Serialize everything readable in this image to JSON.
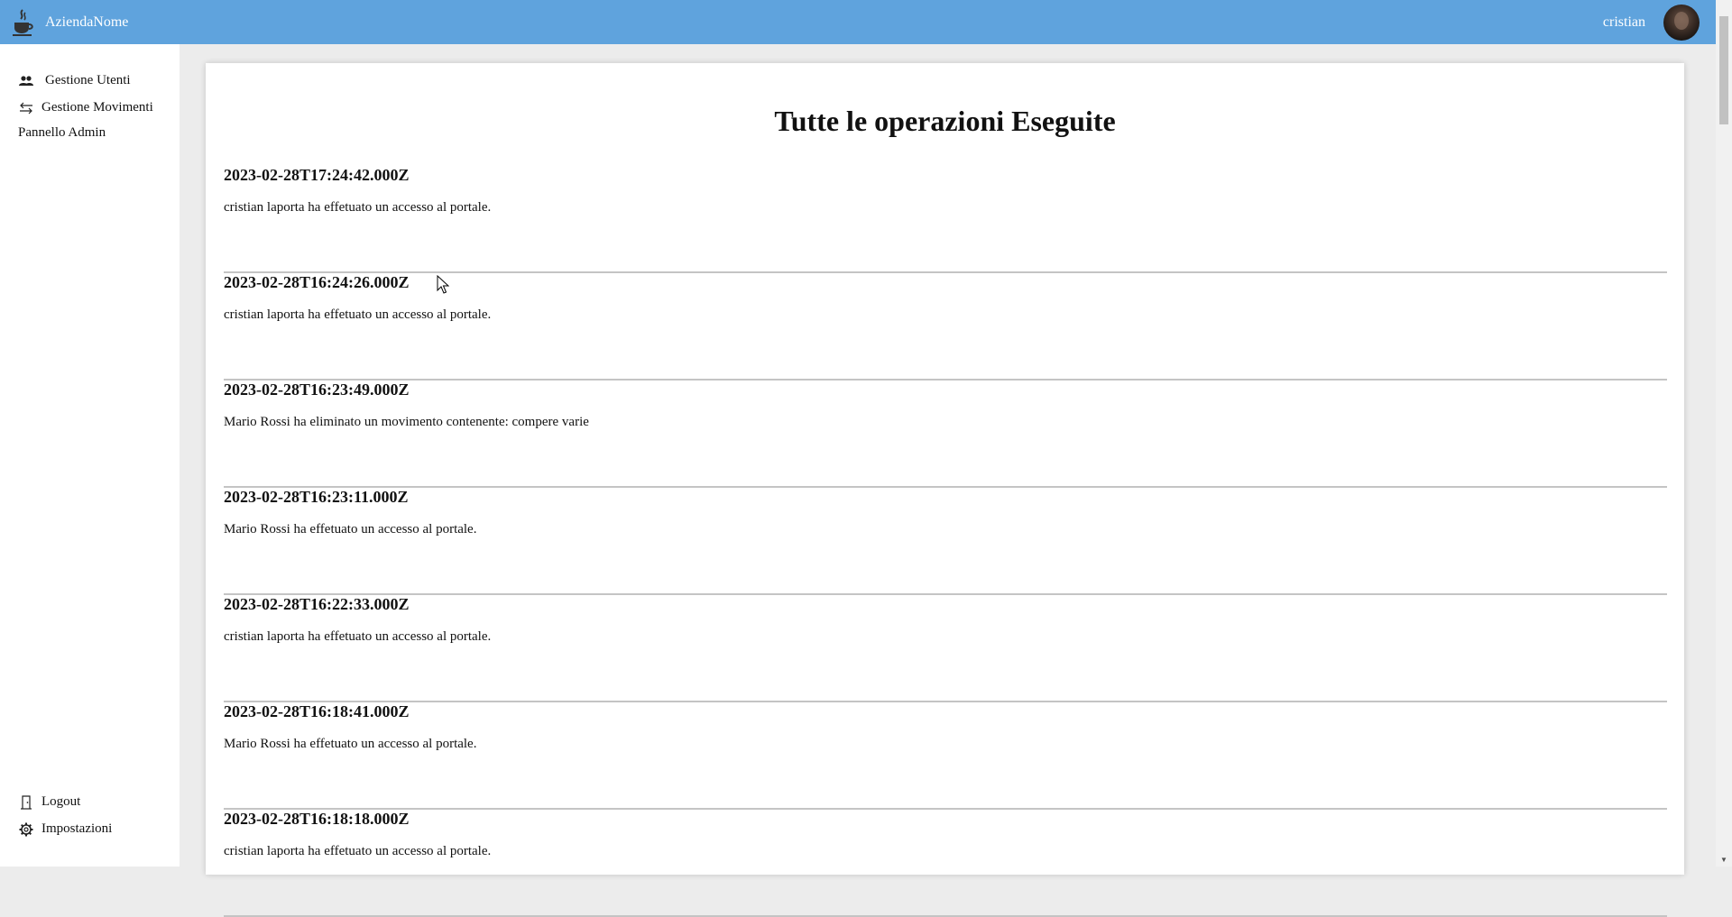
{
  "header": {
    "brand": "AziendaNome",
    "brand_icon": "java-cup-icon",
    "username": "cristian",
    "bar_color": "#5fa3dd"
  },
  "sidebar": {
    "items": [
      {
        "label": "Gestione Utenti",
        "icon": "users-icon"
      },
      {
        "label": "Gestione Movimenti",
        "icon": "arrows-exchange-icon"
      },
      {
        "label": "Pannello Admin",
        "icon": ""
      }
    ],
    "bottom_items": [
      {
        "label": "Logout",
        "icon": "door-icon"
      },
      {
        "label": "Impostazioni",
        "icon": "gear-icon"
      }
    ]
  },
  "main": {
    "title": "Tutte le operazioni Eseguite",
    "operations": [
      {
        "date": "2023-02-28T17:24:42.000Z",
        "text": "cristian laporta ha effetuato un accesso al portale."
      },
      {
        "date": "2023-02-28T16:24:26.000Z",
        "text": "cristian laporta ha effetuato un accesso al portale."
      },
      {
        "date": "2023-02-28T16:23:49.000Z",
        "text": "Mario Rossi ha eliminato un movimento contenente: compere varie"
      },
      {
        "date": "2023-02-28T16:23:11.000Z",
        "text": "Mario Rossi ha effetuato un accesso al portale."
      },
      {
        "date": "2023-02-28T16:22:33.000Z",
        "text": "cristian laporta ha effetuato un accesso al portale."
      },
      {
        "date": "2023-02-28T16:18:41.000Z",
        "text": "Mario Rossi ha effetuato un accesso al portale."
      },
      {
        "date": "2023-02-28T16:18:18.000Z",
        "text": "cristian laporta ha effetuato un accesso al portale."
      }
    ]
  }
}
